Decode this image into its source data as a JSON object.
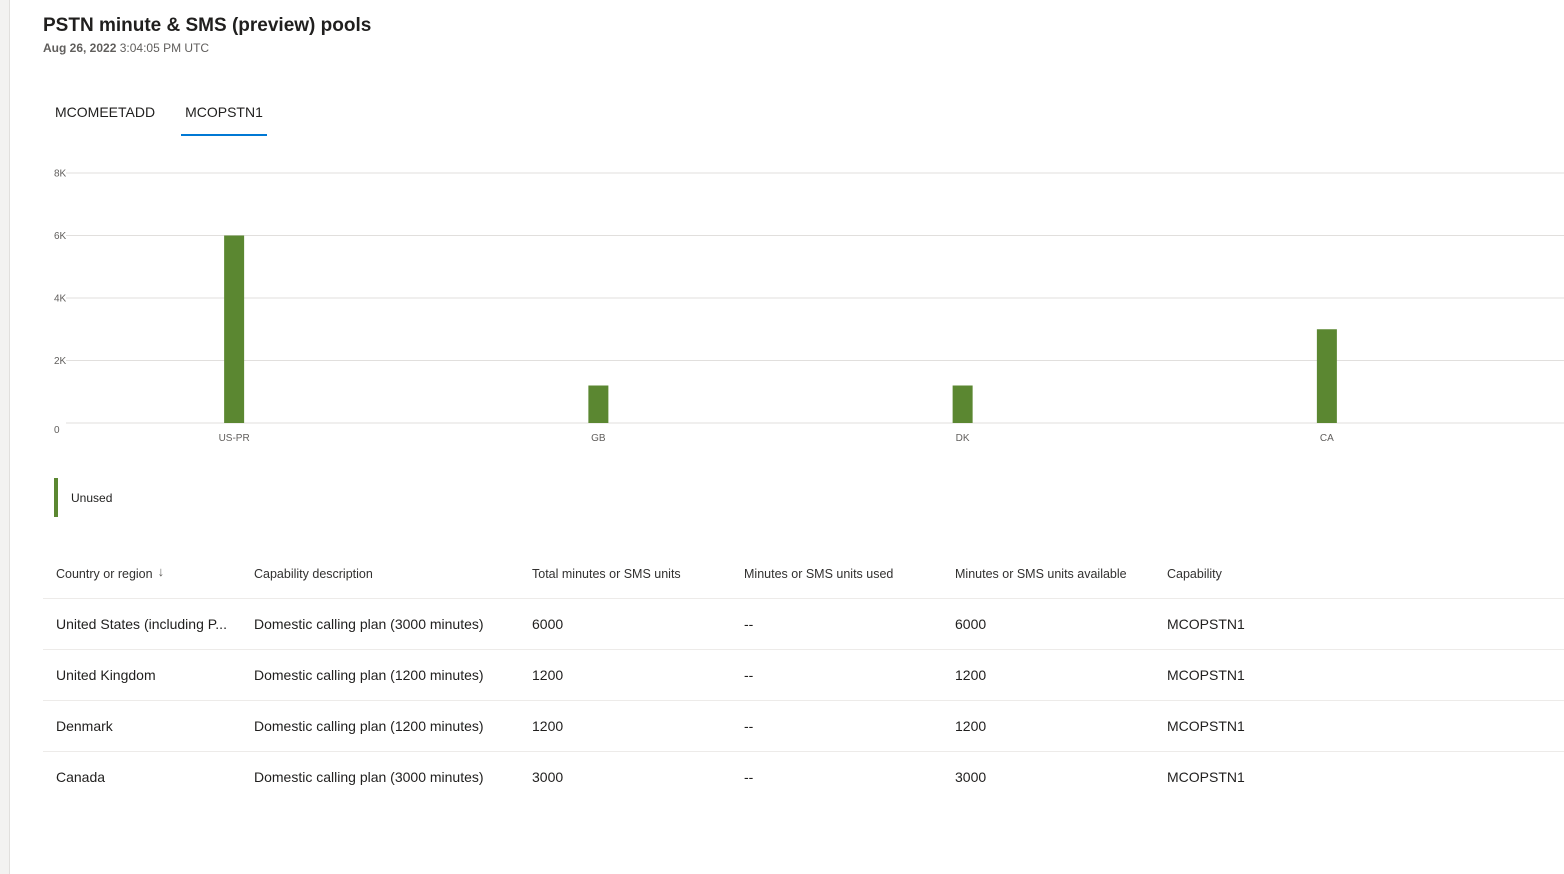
{
  "page": {
    "title": "PSTN minute & SMS (preview) pools",
    "date": "Aug 26, 2022",
    "time": "3:04:05 PM UTC"
  },
  "tabs": [
    {
      "label": "MCOMEETADD",
      "active": false
    },
    {
      "label": "MCOPSTN1",
      "active": true
    }
  ],
  "colors": {
    "bar": "#5b8731",
    "tab_accent": "#0078d4",
    "gridline": "#e1dfdd"
  },
  "chart_data": {
    "type": "bar",
    "categories": [
      "US-PR",
      "GB",
      "DK",
      "CA"
    ],
    "series": [
      {
        "name": "Unused",
        "values": [
          6000,
          1200,
          1200,
          3000
        ]
      }
    ],
    "yticks": [
      "0",
      "2K",
      "4K",
      "6K",
      "8K"
    ],
    "ylim": [
      0,
      8000
    ],
    "grid": true,
    "legend": "bottom-left"
  },
  "legend": {
    "label": "Unused"
  },
  "table": {
    "headers": [
      "Country or region",
      "Capability description",
      "Total minutes or SMS units",
      "Minutes or SMS units used",
      "Minutes or SMS units available",
      "Capability"
    ],
    "sort_icon": "sort-descending-icon",
    "rows": [
      [
        "United States (including P...",
        "Domestic calling plan (3000 minutes)",
        "6000",
        "--",
        "6000",
        "MCOPSTN1"
      ],
      [
        "United Kingdom",
        "Domestic calling plan (1200 minutes)",
        "1200",
        "--",
        "1200",
        "MCOPSTN1"
      ],
      [
        "Denmark",
        "Domestic calling plan (1200 minutes)",
        "1200",
        "--",
        "1200",
        "MCOPSTN1"
      ],
      [
        "Canada",
        "Domestic calling plan (3000 minutes)",
        "3000",
        "--",
        "3000",
        "MCOPSTN1"
      ]
    ]
  }
}
